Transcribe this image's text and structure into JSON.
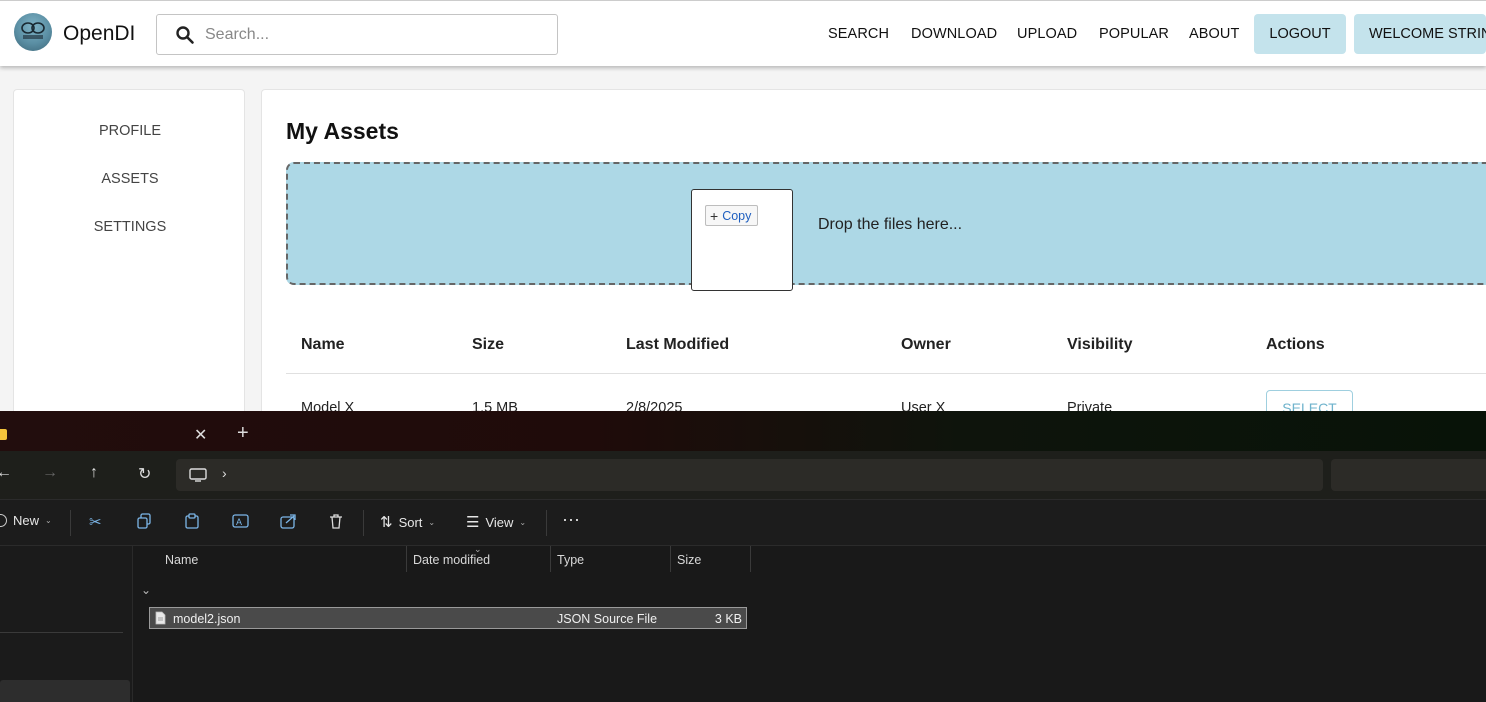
{
  "app": {
    "brand": "OpenDI",
    "logo_icon": "opendi-logo-icon",
    "search": {
      "placeholder": "Search..."
    },
    "nav": {
      "search": "SEARCH",
      "download": "DOWNLOAD",
      "upload": "UPLOAD",
      "popular": "POPULAR",
      "about": "ABOUT"
    },
    "logout": "LOGOUT",
    "welcome": "WELCOME STRIN",
    "accent_color": "#c4e3ec",
    "dropzone_color": "#add8e6"
  },
  "sidebar": {
    "items": [
      "PROFILE",
      "ASSETS",
      "SETTINGS"
    ]
  },
  "main": {
    "title": "My Assets",
    "dropzone_text": "Drop the files here...",
    "columns": [
      "Name",
      "Size",
      "Last Modified",
      "Owner",
      "Visibility",
      "Actions"
    ],
    "rows": [
      {
        "name": "Model X",
        "size": "1.5 MB",
        "modified": "2/8/2025",
        "owner": "User X",
        "visibility": "Private",
        "action": "SELECT"
      }
    ]
  },
  "drag": {
    "tooltip": "Copy",
    "tooltip_icon": "plus-icon"
  },
  "explorer": {
    "toolbar": {
      "new": "New",
      "sort": "Sort",
      "view": "View"
    },
    "columns": [
      "Name",
      "Date modified",
      "Type",
      "Size"
    ],
    "files": [
      {
        "name": "model2.json",
        "type": "JSON Source File",
        "size": "3 KB"
      }
    ]
  }
}
